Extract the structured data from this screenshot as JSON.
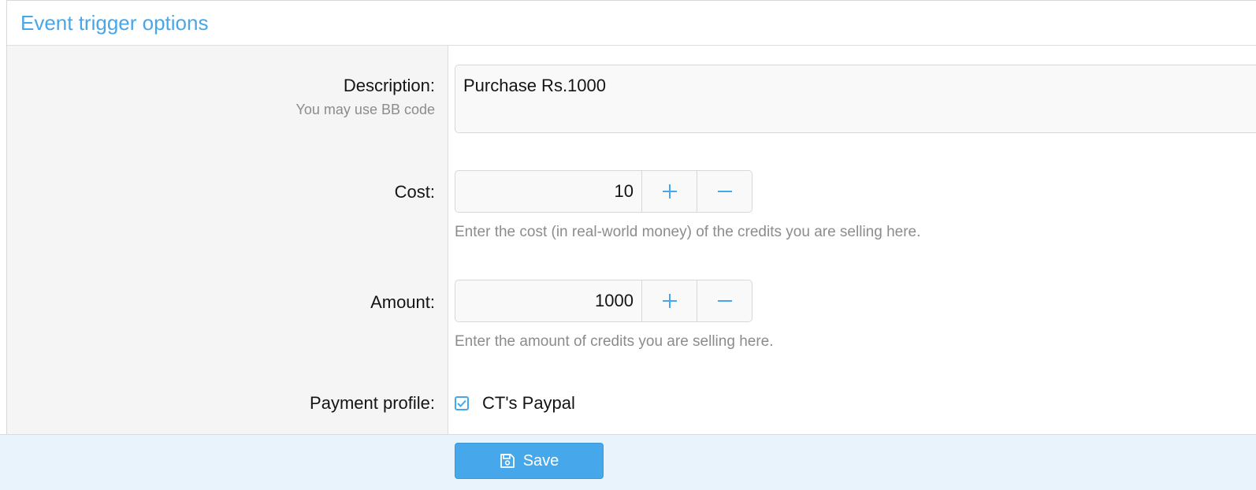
{
  "panel": {
    "title": "Event trigger options"
  },
  "form": {
    "description": {
      "label": "Description:",
      "hint": "You may use BB code",
      "value": "Purchase Rs.1000"
    },
    "cost": {
      "label": "Cost:",
      "value": "10",
      "hint": "Enter the cost (in real-world money) of the credits you are selling here."
    },
    "amount": {
      "label": "Amount:",
      "value": "1000",
      "hint": "Enter the amount of credits you are selling here."
    },
    "payment_profile": {
      "label": "Payment profile:",
      "option_label": "CT's Paypal",
      "checked": true
    }
  },
  "footer": {
    "save_label": "Save"
  },
  "icons": {
    "plus": "plus-icon",
    "minus": "minus-icon",
    "check": "check-icon",
    "save": "save-icon"
  },
  "colors": {
    "accent": "#47a7eb",
    "footer_bg": "#e8f3fb",
    "label_col_bg": "#f5f5f5",
    "hint_text": "#8c8c8c"
  }
}
